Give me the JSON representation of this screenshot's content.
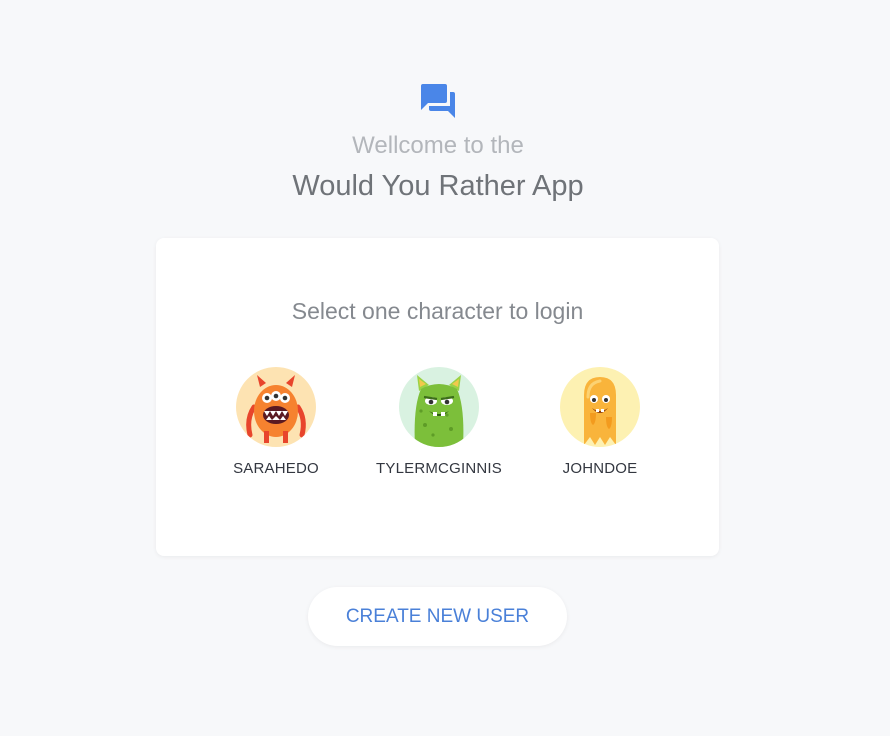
{
  "header": {
    "welcome": "Wellcome to the",
    "title": "Would You Rather App"
  },
  "login_card": {
    "title": "Select one character to login",
    "characters": [
      {
        "name": "SARAHEDO",
        "avatar_bg": "#fde3b2"
      },
      {
        "name": "TYLERMCGINNIS",
        "avatar_bg": "#d9f2e1"
      },
      {
        "name": "JOHNDOE",
        "avatar_bg": "#fdf1b2"
      }
    ]
  },
  "actions": {
    "create_user_label": "CREATE NEW USER"
  },
  "colors": {
    "accent": "#4a80d8",
    "background": "#f7f8fa",
    "card": "#ffffff"
  }
}
